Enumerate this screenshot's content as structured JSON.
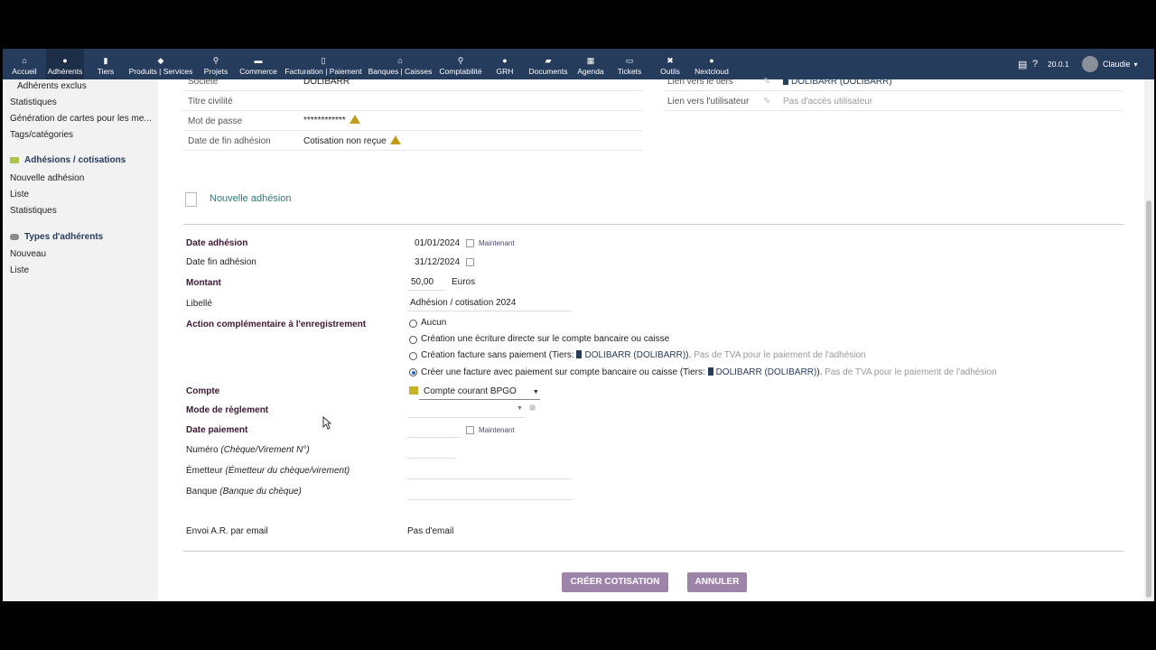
{
  "topnav": [
    {
      "label": "Accueil",
      "icon": "home-icon",
      "glyph": "⌂"
    },
    {
      "label": "Adhérents",
      "icon": "user-icon",
      "glyph": "●"
    },
    {
      "label": "Tiers",
      "icon": "building-icon",
      "glyph": "▮"
    },
    {
      "label": "Produits | Services",
      "icon": "cube-icon",
      "glyph": "◆"
    },
    {
      "label": "Projets",
      "icon": "sitemap-icon",
      "glyph": "⚲"
    },
    {
      "label": "Commerce",
      "icon": "briefcase-icon",
      "glyph": "▬"
    },
    {
      "label": "Facturation | Paiement",
      "icon": "file-invoice-icon",
      "glyph": "▯"
    },
    {
      "label": "Banques | Caisses",
      "icon": "bank-icon",
      "glyph": "⌂"
    },
    {
      "label": "Comptabilité",
      "icon": "search-dollar-icon",
      "glyph": "⚲"
    },
    {
      "label": "GRH",
      "icon": "user-tie-icon",
      "glyph": "●"
    },
    {
      "label": "Documents",
      "icon": "folder-icon",
      "glyph": "▰"
    },
    {
      "label": "Agenda",
      "icon": "calendar-icon",
      "glyph": "▦"
    },
    {
      "label": "Tickets",
      "icon": "ticket-icon",
      "glyph": "▭"
    },
    {
      "label": "Outils",
      "icon": "tools-icon",
      "glyph": "✖"
    },
    {
      "label": "Nextcloud",
      "icon": "globe-icon",
      "glyph": "●"
    }
  ],
  "topright": {
    "version": "20.0.1",
    "user": "Claudie"
  },
  "leftmenu": {
    "adherents_exclus": "Adhérents exclus",
    "statistiques": "Statistiques",
    "generation": "Génération de cartes pour les me...",
    "tags": "Tags/catégories",
    "section2": "Adhésions / cotisations",
    "nouvelle_adhesion": "Nouvelle adhésion",
    "liste": "Liste",
    "statistiques2": "Statistiques",
    "section3": "Types d'adhérents",
    "nouveau": "Nouveau",
    "liste2": "Liste"
  },
  "card": {
    "societe_label": "Société",
    "societe_value": "DOLIBARR",
    "titre_label": "Titre civilité",
    "mdp_label": "Mot de passe",
    "mdp_value": "************",
    "datefin_label": "Date de fin adhésion",
    "datefin_value": "Cotisation non reçue",
    "lien_tiers_label": "Lien vers le tiers",
    "lien_tiers_value": "DOLIBARR (DOLIBARR)",
    "lien_user_label": "Lien vers l'utilisateur",
    "lien_user_value": "Pas d'accès utilisateur"
  },
  "form": {
    "title": "Nouvelle adhésion",
    "date_adhesion_label": "Date adhésion",
    "date_adhesion_value": "01/01/2024",
    "maintenant": "Maintenant",
    "date_fin_label": "Date fin adhésion",
    "date_fin_value": "31/12/2024",
    "montant_label": "Montant",
    "montant_value": "50,00",
    "montant_unit": "Euros",
    "libelle_label": "Libellé",
    "libelle_value": "Adhésion / cotisation 2024",
    "action_label": "Action complémentaire à l'enregistrement",
    "opt_aucun": "Aucun",
    "opt_ecriture": "Création une écriture directe sur le compte bancaire ou caisse",
    "opt_facture_pre": "Création facture sans paiement (Tiers: ",
    "opt_facture_tiers": "DOLIBARR (DOLIBARR)",
    "opt_facture_post": ").",
    "opt_facture_note": "Pas de TVA pour le paiement de l'adhésion",
    "opt_paiement_pre": "Créer une facture avec paiement sur compte bancaire ou caisse (Tiers: ",
    "opt_paiement_tiers": "DOLIBARR (DOLIBARR)",
    "opt_paiement_post": ").",
    "opt_paiement_note": "Pas de TVA pour le paiement de l'adhésion",
    "compte_label": "Compte",
    "compte_value": "Compte courant BPGO",
    "mode_label": "Mode de règlement",
    "date_paiement_label": "Date paiement",
    "numero_label": "Numéro",
    "numero_hint": "(Chèque/Virement N°)",
    "emetteur_label": "Émetteur",
    "emetteur_hint": "(Émetteur du chèque/virement)",
    "banque_label": "Banque",
    "banque_hint": "(Banque du chèque)",
    "envoi_label": "Envoi A.R. par email",
    "envoi_value": "Pas d'email",
    "btn_creer": "CRÉER COTISATION",
    "btn_annuler": "ANNULER"
  }
}
